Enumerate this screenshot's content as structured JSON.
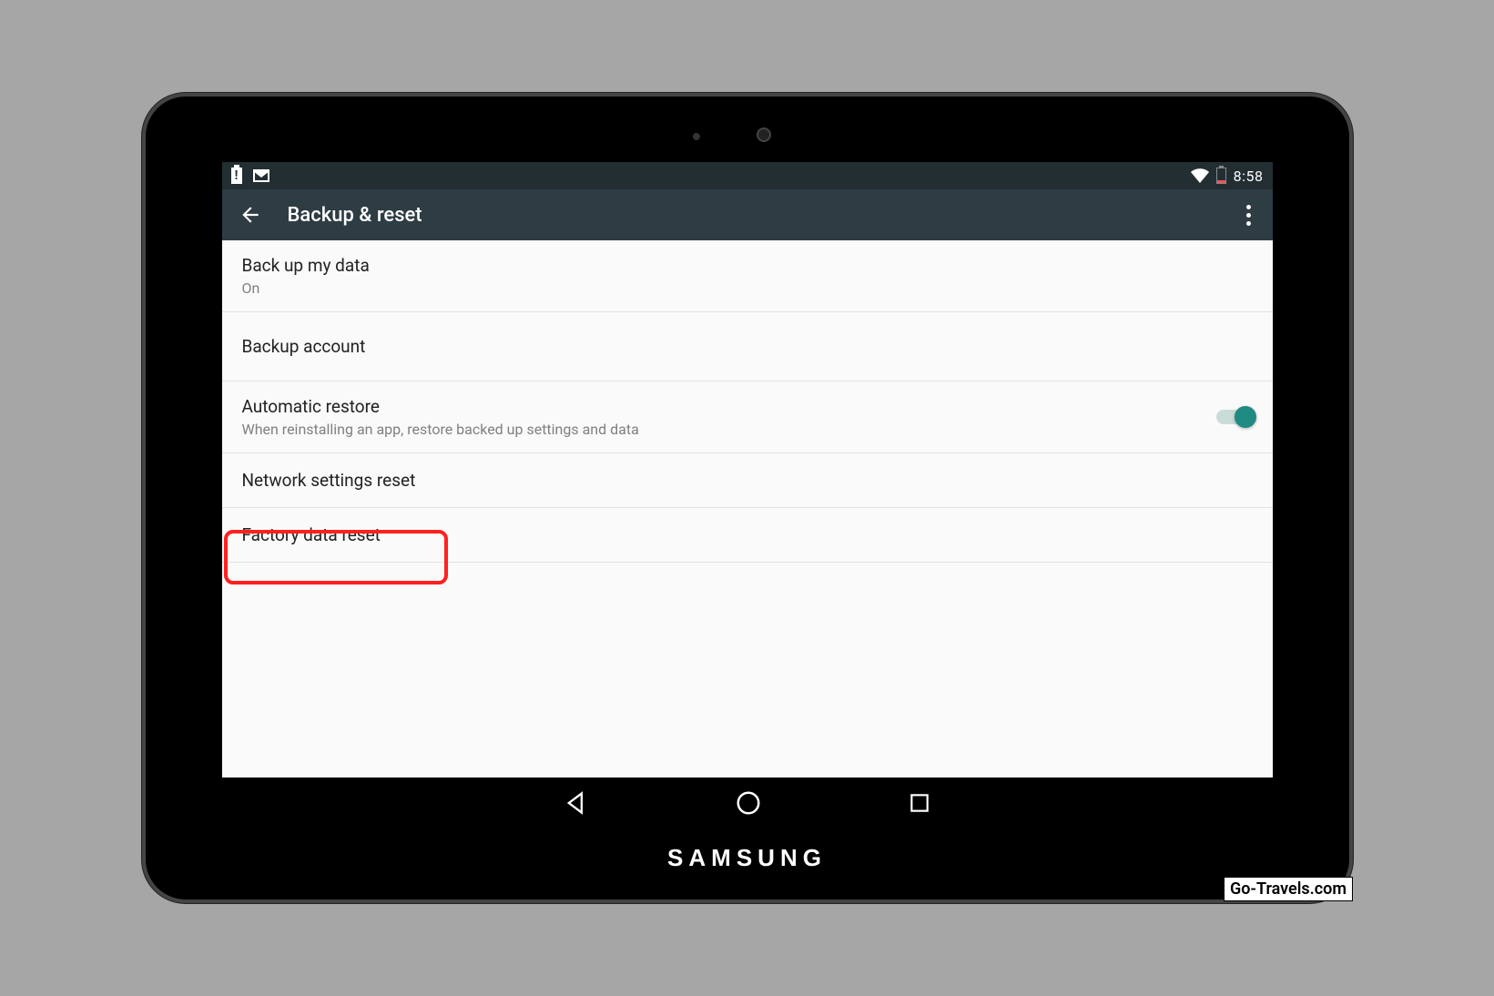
{
  "status": {
    "time": "8:58"
  },
  "appbar": {
    "title": "Backup & reset"
  },
  "rows": {
    "backup_my_data": {
      "title": "Back up my data",
      "sub": "On"
    },
    "backup_account": {
      "title": "Backup account"
    },
    "automatic_restore": {
      "title": "Automatic restore",
      "sub": "When reinstalling an app, restore backed up settings and data"
    },
    "network_reset": {
      "title": "Network settings reset"
    },
    "factory_reset": {
      "title": "Factory data reset"
    }
  },
  "brand": "SAMSUNG",
  "watermark": "Go-Travels.com"
}
